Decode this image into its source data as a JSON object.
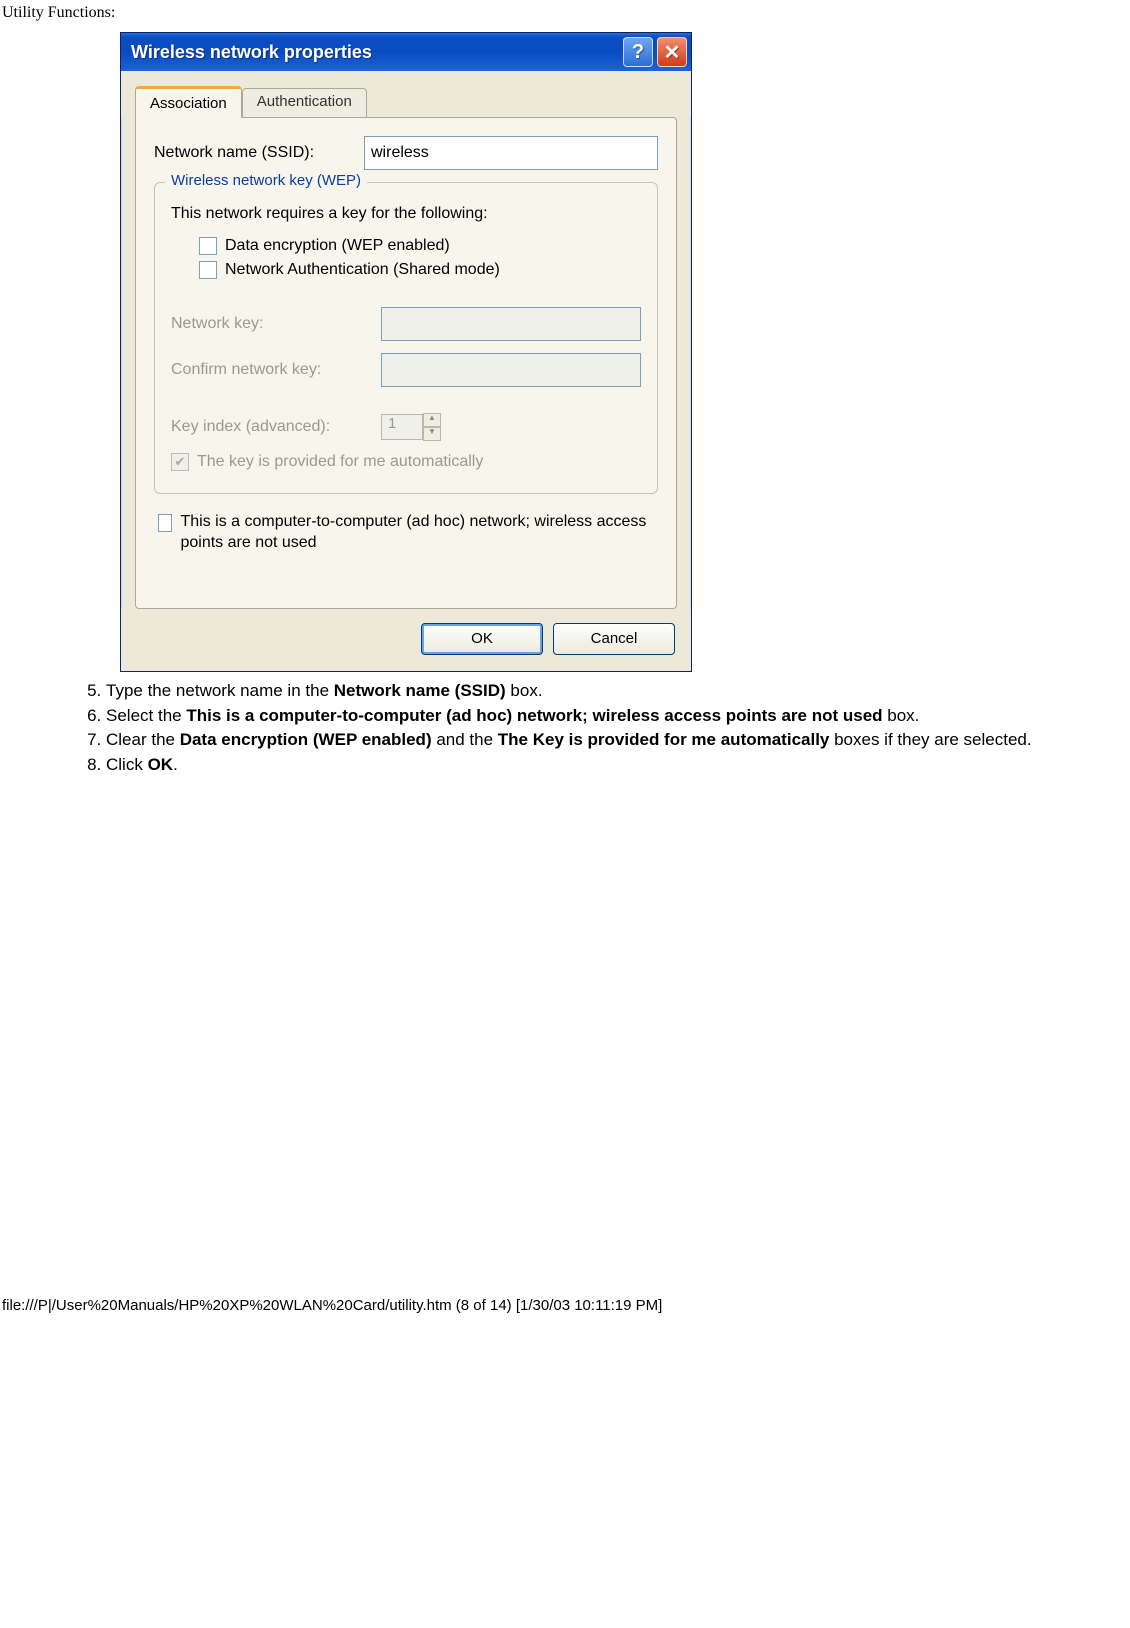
{
  "page_header": "Utility Functions:",
  "dialog": {
    "title": "Wireless network properties",
    "help_glyph": "?",
    "close_glyph": "✕",
    "tabs": {
      "association": "Association",
      "authentication": "Authentication"
    },
    "ssid_label": "Network name (SSID):",
    "ssid_value": "wireless",
    "group_legend": "Wireless network key (WEP)",
    "requires_text": "This network requires a key for the following:",
    "chk_wep": "Data encryption (WEP enabled)",
    "chk_auth": "Network Authentication (Shared mode)",
    "netkey_label": "Network key:",
    "confirm_label": "Confirm network key:",
    "keyindex_label": "Key index (advanced):",
    "keyindex_value": "1",
    "autokey_label": "The key is provided for me automatically",
    "adhoc_label": "This is a computer-to-computer (ad hoc) network; wireless access points are not used",
    "ok_label": "OK",
    "cancel_label": "Cancel"
  },
  "instructions": {
    "start": 5,
    "items": [
      {
        "pre": "Type the network name in the ",
        "b1": "Network name (SSID)",
        "post": " box."
      },
      {
        "pre": "Select the ",
        "b1": "This is a computer-to-computer (ad hoc) network; wireless access points are not used",
        "post": " box."
      },
      {
        "pre": "Clear the ",
        "b1": "Data encryption (WEP enabled)",
        "mid": " and the ",
        "b2": "The Key is provided for me automatically",
        "post": " boxes if they are selected."
      },
      {
        "pre": "Click ",
        "b1": "OK",
        "post": "."
      }
    ]
  },
  "footer": "file:///P|/User%20Manuals/HP%20XP%20WLAN%20Card/utility.htm (8 of 14) [1/30/03 10:11:19 PM]"
}
